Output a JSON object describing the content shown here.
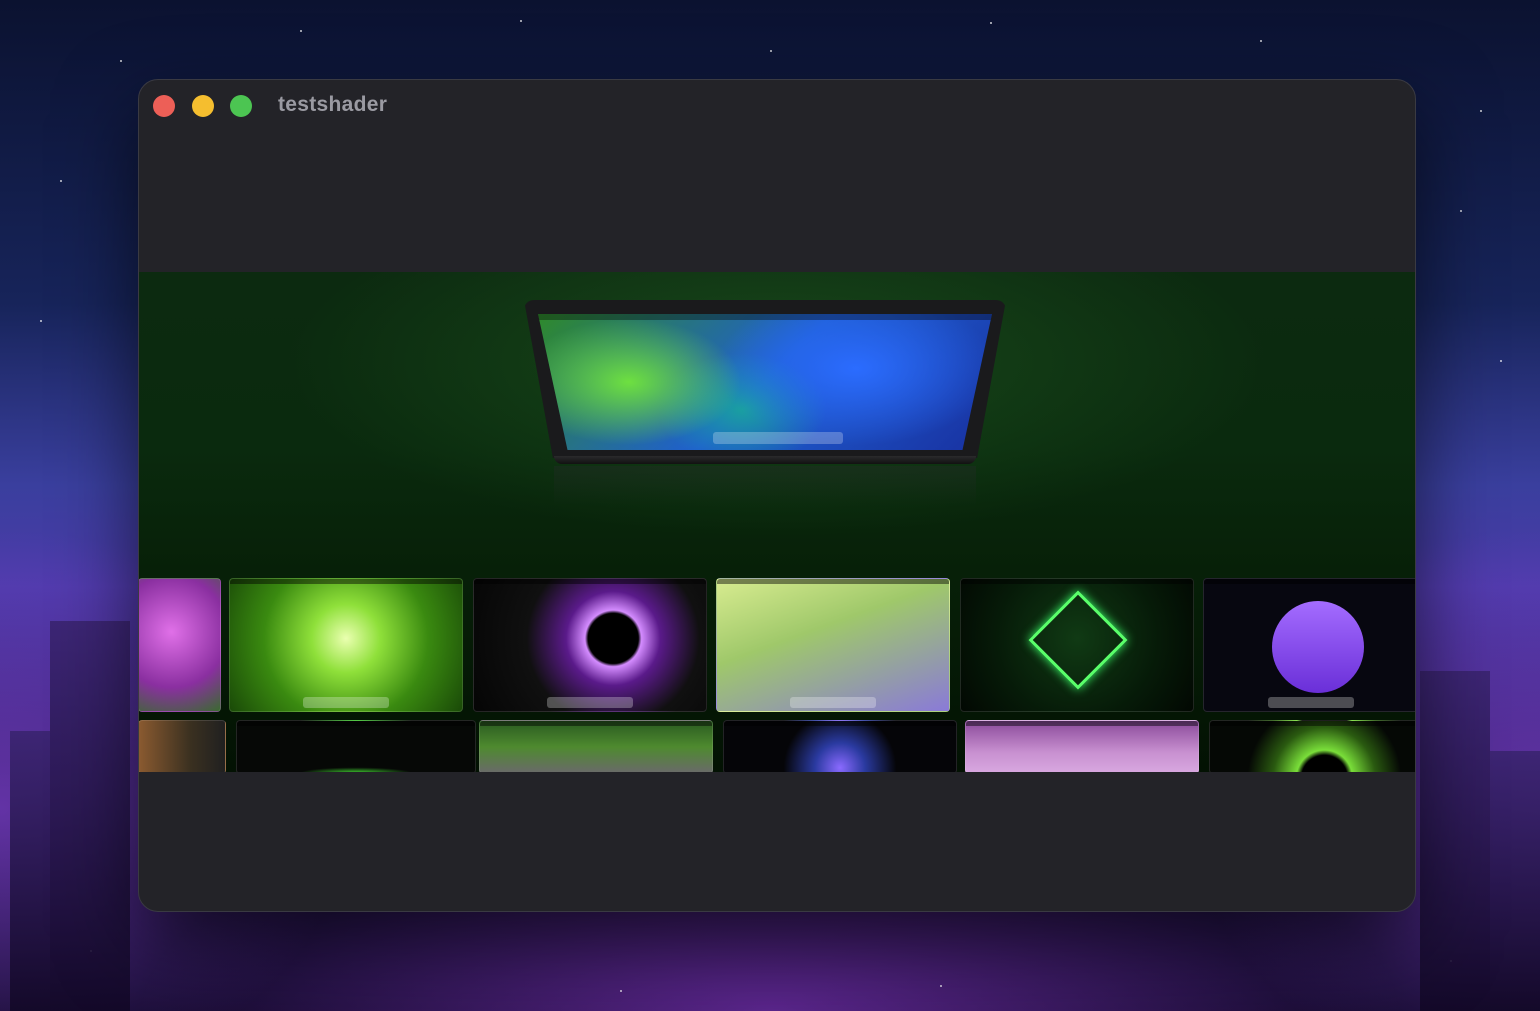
{
  "window": {
    "title": "testshader"
  },
  "hero": {
    "device": "laptop-preview",
    "wallpaper": "green-blue-petals"
  },
  "thumbnails": [
    {
      "row": 1,
      "theme": "purple-blossom-garden",
      "color": "#b048c0"
    },
    {
      "row": 1,
      "theme": "green-tunnel-light",
      "color": "#6fcf2a"
    },
    {
      "row": 1,
      "theme": "purple-ringed-black-hole",
      "color": "#9b3bd6"
    },
    {
      "row": 1,
      "theme": "lime-abstract-geometry",
      "color": "#c9e07a"
    },
    {
      "row": 1,
      "theme": "neon-diamond-grid",
      "color": "#3aff6a"
    },
    {
      "row": 1,
      "theme": "purple-sun-synthwave",
      "color": "#8a4df0"
    },
    {
      "row": 2,
      "theme": "brown-fish",
      "color": "#8a5a30"
    },
    {
      "row": 2,
      "theme": "green-horizon",
      "color": "#39c12a"
    },
    {
      "row": 2,
      "theme": "green-clouds",
      "color": "#4e8a2f"
    },
    {
      "row": 2,
      "theme": "neon-swirl",
      "color": "#6a5aff"
    },
    {
      "row": 2,
      "theme": "pink-coastline",
      "color": "#c07ac8"
    },
    {
      "row": 2,
      "theme": "green-eye-iris",
      "color": "#7adf3a"
    }
  ]
}
